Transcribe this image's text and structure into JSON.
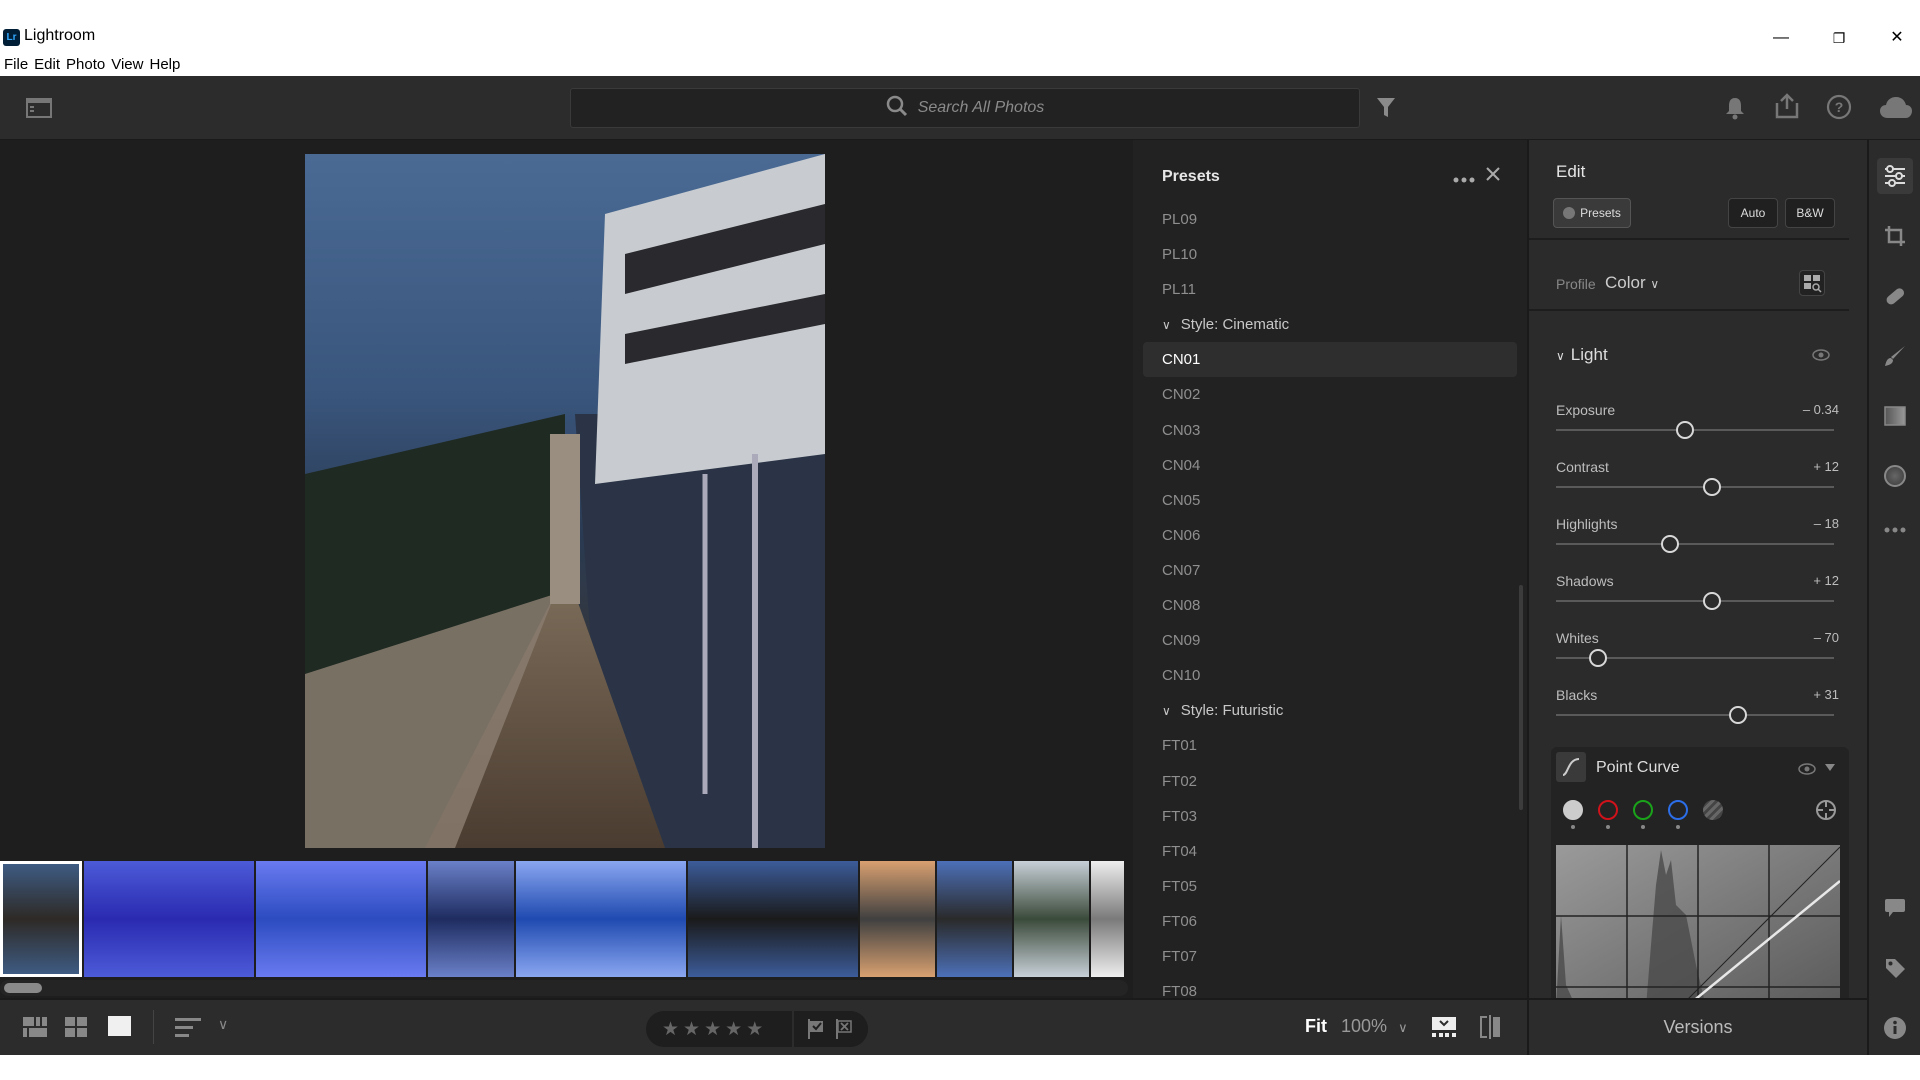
{
  "window": {
    "app_name": "Lightroom",
    "app_icon_text": "Lr",
    "controls": {
      "minimize": "—",
      "restore": "❐",
      "close": "✕"
    }
  },
  "menu": [
    "File",
    "Edit",
    "Photo",
    "View",
    "Help"
  ],
  "toolbar": {
    "search_placeholder": "Search All Photos",
    "icons": [
      "panel-toggle-icon",
      "search-icon",
      "filter-icon",
      "bell-icon",
      "share-icon",
      "help-icon",
      "cloud-icon"
    ]
  },
  "filmstrip": {
    "selected_index": 0,
    "thumbnails": [
      {
        "subject": "bridge walkway dusk",
        "colors": [
          "#3f5e88",
          "#2e2a26"
        ]
      },
      {
        "subject": "harbour houses reflection night",
        "colors": [
          "#4c5bd8",
          "#2a2ab0"
        ]
      },
      {
        "subject": "harbour houses reflection night",
        "colors": [
          "#6a7af0",
          "#2c4cc0"
        ]
      },
      {
        "subject": "harbour houses reflection",
        "colors": [
          "#6a80c8",
          "#1e2c60"
        ]
      },
      {
        "subject": "harbour houses reflection orange lights",
        "colors": [
          "#8aa6f0",
          "#1f4ab0"
        ]
      },
      {
        "subject": "suspension bridge rail",
        "colors": [
          "#3c5c9a",
          "#1a1a1a"
        ]
      },
      {
        "subject": "river gorge sunset",
        "colors": [
          "#d8a070",
          "#404040"
        ]
      },
      {
        "subject": "bridge walkway",
        "colors": [
          "#4c70b8",
          "#2a2a2a"
        ]
      },
      {
        "subject": "river plants",
        "colors": [
          "#c8d0d8",
          "#3a4a3a"
        ]
      },
      {
        "subject": "bridge tower",
        "colors": [
          "#eeeeee",
          "#7a7a7a"
        ]
      }
    ]
  },
  "presets": {
    "title": "Presets",
    "more_icon": "more-icon",
    "close_icon": "close-icon",
    "items": [
      {
        "label": "PL09",
        "type": "preset"
      },
      {
        "label": "PL10",
        "type": "preset"
      },
      {
        "label": "PL11",
        "type": "preset"
      },
      {
        "label": "Style: Cinematic",
        "type": "group"
      },
      {
        "label": "CN01",
        "type": "preset",
        "selected": true
      },
      {
        "label": "CN02",
        "type": "preset"
      },
      {
        "label": "CN03",
        "type": "preset"
      },
      {
        "label": "CN04",
        "type": "preset"
      },
      {
        "label": "CN05",
        "type": "preset"
      },
      {
        "label": "CN06",
        "type": "preset"
      },
      {
        "label": "CN07",
        "type": "preset"
      },
      {
        "label": "CN08",
        "type": "preset"
      },
      {
        "label": "CN09",
        "type": "preset"
      },
      {
        "label": "CN10",
        "type": "preset"
      },
      {
        "label": "Style: Futuristic",
        "type": "group"
      },
      {
        "label": "FT01",
        "type": "preset"
      },
      {
        "label": "FT02",
        "type": "preset"
      },
      {
        "label": "FT03",
        "type": "preset"
      },
      {
        "label": "FT04",
        "type": "preset"
      },
      {
        "label": "FT05",
        "type": "preset"
      },
      {
        "label": "FT06",
        "type": "preset"
      },
      {
        "label": "FT07",
        "type": "preset"
      },
      {
        "label": "FT08",
        "type": "preset"
      }
    ]
  },
  "edit": {
    "title": "Edit",
    "presets_button": "Presets",
    "auto_button": "Auto",
    "bw_button": "B&W",
    "profile_label": "Profile",
    "profile_value": "Color",
    "light_section": "Light",
    "sliders": [
      {
        "label": "Exposure",
        "value": "– 0.34",
        "position": 0.465
      },
      {
        "label": "Contrast",
        "value": "+ 12",
        "position": 0.56
      },
      {
        "label": "Highlights",
        "value": "– 18",
        "position": 0.41
      },
      {
        "label": "Shadows",
        "value": "+ 12",
        "position": 0.56
      },
      {
        "label": "Whites",
        "value": "– 70",
        "position": 0.15
      },
      {
        "label": "Blacks",
        "value": "+ 31",
        "position": 0.655
      }
    ],
    "point_curve": {
      "title": "Point Curve",
      "channels": [
        {
          "name": "rgb",
          "color": "#cccccc"
        },
        {
          "name": "red",
          "color": "#d0121b"
        },
        {
          "name": "green",
          "color": "#1aa31a"
        },
        {
          "name": "blue",
          "color": "#2c6ee8"
        }
      ]
    }
  },
  "rail": {
    "icons": [
      "edit-sliders-icon",
      "crop-icon",
      "healing-icon",
      "brush-icon",
      "linear-gradient-icon",
      "radial-gradient-icon",
      "more-icon",
      "comment-icon",
      "tag-icon",
      "info-icon"
    ]
  },
  "bottombar": {
    "fit_label": "Fit",
    "zoom_label": "100%",
    "stars": [
      "★",
      "★",
      "★",
      "★",
      "★"
    ],
    "versions_label": "Versions"
  }
}
